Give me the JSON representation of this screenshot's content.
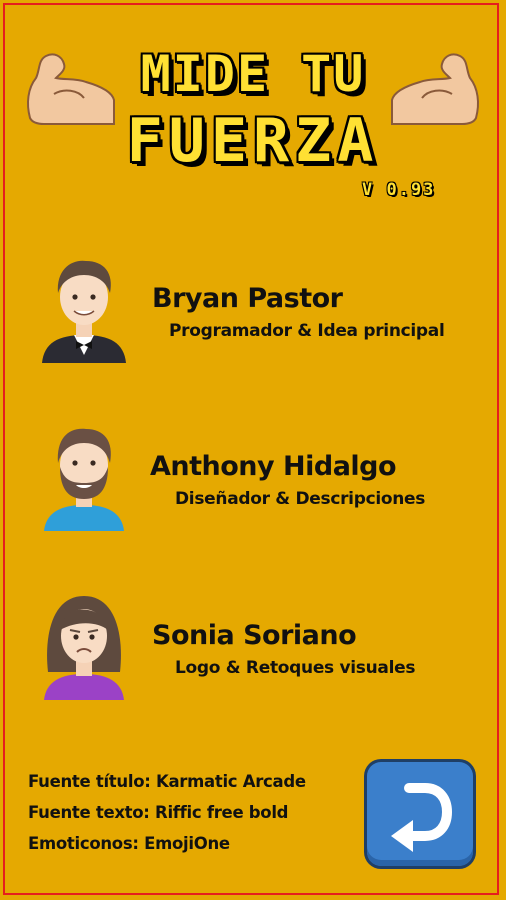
{
  "header": {
    "title_line1": "MIDE TU",
    "title_line2": "FUERZA",
    "version": "V 0.93"
  },
  "credits": [
    {
      "name": "Bryan Pastor",
      "role": "Programador & Idea principal",
      "avatar": "man-in-tuxedo-icon"
    },
    {
      "name": "Anthony Hidalgo",
      "role": "Diseñador & Descripciones",
      "avatar": "bearded-man-icon"
    },
    {
      "name": "Sonia Soriano",
      "role": "Logo & Retoques visuales",
      "avatar": "woman-pouting-icon"
    }
  ],
  "footer": {
    "title_font": "Fuente título: Karmatic Arcade",
    "text_font": "Fuente texto: Riffic free bold",
    "emoticons": "Emoticonos: EmojiOne"
  },
  "back_button": {
    "icon": "return-arrow-icon"
  },
  "colors": {
    "background": "#E5A901",
    "border": "#E51E1E",
    "title": "#FFE033",
    "button": "#3B7FCB"
  }
}
